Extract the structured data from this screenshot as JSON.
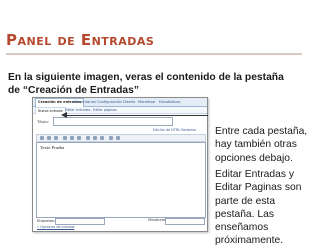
{
  "slide": {
    "title": "Panel de Entradas",
    "intro": "En la siguiente imagen, veras el contenido de la pestaña de “Creación de Entradas”",
    "note1": "Entre cada pestaña, hay también otras opciones debajo.",
    "note2": "Editar Entradas y Editar Paginas son parte de esta pestaña. Las enseñamos próximamente."
  },
  "screenshot": {
    "tabs": [
      "Creación de entradas",
      "Comentarios",
      "Configuración",
      "Diseño",
      "Monetizar",
      "Estadísticas"
    ],
    "subtabs": [
      "Nueva entrada",
      "Editar entradas",
      "Editar páginas"
    ],
    "title_label": "Título:",
    "edit_tabs": "Edición de HTML  Redactar",
    "editor_text": "Texto Prueba",
    "footer_label": "Etiquetas:",
    "footer_link": "» Opciones de entrada",
    "footer_right": "Miniaturas"
  }
}
